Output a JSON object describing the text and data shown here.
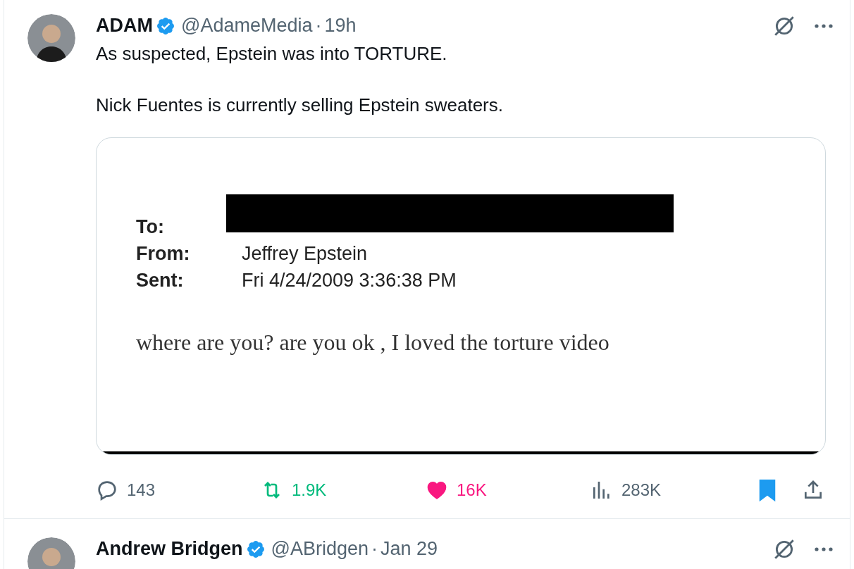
{
  "tweets": [
    {
      "name": "ADAM",
      "verified": true,
      "handle": "@AdameMedia",
      "separator": "·",
      "time": "19h",
      "text": [
        "As suspected, Epstein was into TORTURE.",
        "Nick Fuentes is currently selling Epstein sweaters."
      ],
      "document": {
        "fields": [
          {
            "label": "To:",
            "kind": "redacted"
          },
          {
            "label": "From:",
            "kind": "text",
            "value": "Jeffrey Epstein"
          },
          {
            "label": "Sent:",
            "kind": "text",
            "value": "Fri 4/24/2009 3:36:38 PM"
          }
        ],
        "body": "where are you? are you ok , I loved the torture video"
      },
      "actions": {
        "replies": "143",
        "reposts": "1.9K",
        "reposted": true,
        "likes": "16K",
        "liked": true,
        "views": "283K",
        "bookmarked": true
      }
    },
    {
      "name": "Andrew Bridgen",
      "verified": true,
      "handle": "@ABridgen",
      "separator": "·",
      "time": "Jan 29"
    }
  ]
}
